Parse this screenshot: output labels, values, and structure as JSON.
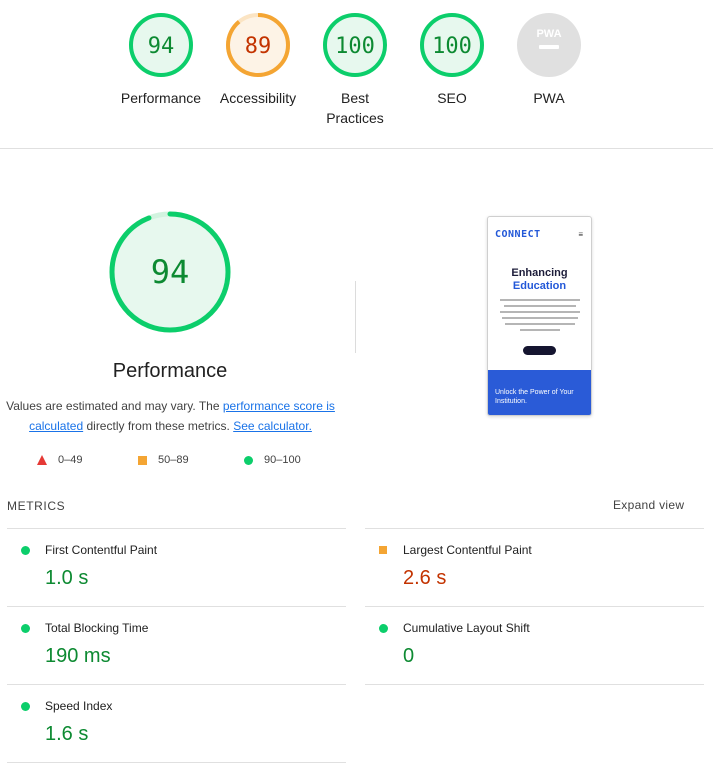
{
  "gauges": [
    {
      "score": "94",
      "label": "Performance",
      "value": 94,
      "color": "#0cce6b",
      "fill": "#e7f8ee",
      "text_color": "#0d8a32"
    },
    {
      "score": "89",
      "label": "Accessibility",
      "value": 89,
      "color": "#f4a533",
      "fill": "#fdf3e6",
      "text_color": "#c33300"
    },
    {
      "score": "100",
      "label": "Best Practices",
      "value": 100,
      "color": "#0cce6b",
      "fill": "#e7f8ee",
      "text_color": "#0d8a32"
    },
    {
      "score": "100",
      "label": "SEO",
      "value": 100,
      "color": "#0cce6b",
      "fill": "#e7f8ee",
      "text_color": "#0d8a32"
    },
    {
      "score": "PWA",
      "label": "PWA",
      "color": "#cccccc",
      "fill": "#e6e6e6",
      "text_color": "#ffffff"
    }
  ],
  "main": {
    "score": "94",
    "value": 94,
    "title": "Performance",
    "note_prefix": "Values are estimated and may vary. The ",
    "note_link1": "performance score is calculated",
    "note_mid": " directly from these metrics. ",
    "note_link2": "See calculator.",
    "legend": {
      "fail": "0–49",
      "average": "50–89",
      "pass": "90–100"
    }
  },
  "screenshot": {
    "logo": "CONNECT",
    "menu_icon": "hamburger-icon",
    "heading_1": "Enhancing",
    "heading_2": "Education",
    "band_text": "Unlock the Power of Your Institution."
  },
  "metrics": {
    "header": "METRICS",
    "expand_label": "Expand view",
    "items": [
      {
        "label": "First Contentful Paint",
        "value": "1.0 s",
        "rating": "pass"
      },
      {
        "label": "Largest Contentful Paint",
        "value": "2.6 s",
        "rating": "average"
      },
      {
        "label": "Total Blocking Time",
        "value": "190 ms",
        "rating": "pass"
      },
      {
        "label": "Cumulative Layout Shift",
        "value": "0",
        "rating": "pass"
      },
      {
        "label": "Speed Index",
        "value": "1.6 s",
        "rating": "pass"
      }
    ]
  },
  "colors": {
    "pass": "#0cce6b",
    "average": "#f4a533",
    "fail": "#e53935",
    "link": "#1a73e8"
  }
}
